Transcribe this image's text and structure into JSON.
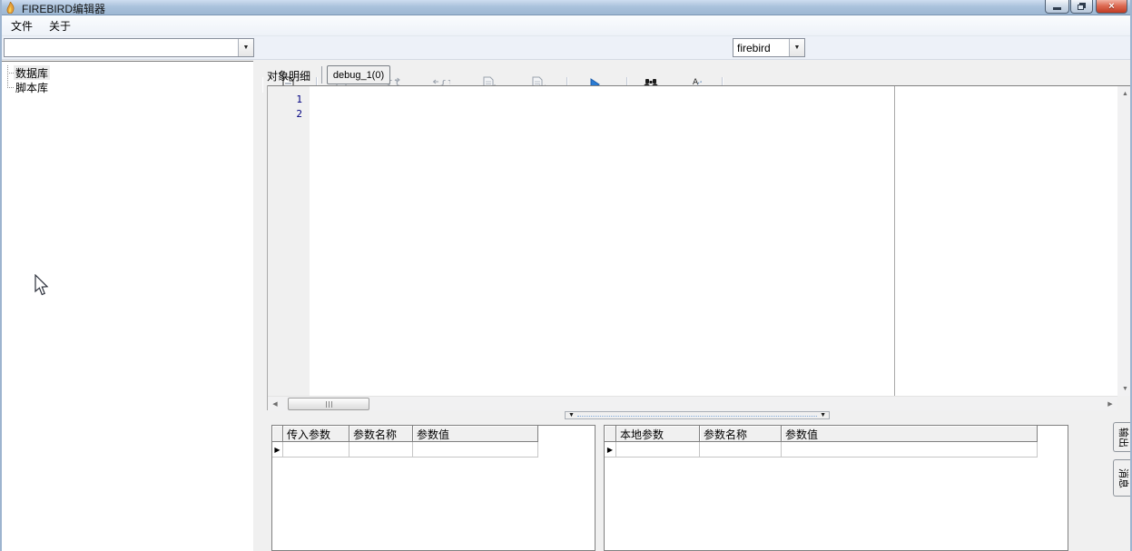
{
  "window": {
    "title": "FIREBIRD编辑器"
  },
  "menubar": {
    "items": [
      {
        "label": "文件"
      },
      {
        "label": "关于"
      }
    ]
  },
  "toolbar": {
    "object_selector": {
      "value": ""
    },
    "database_selector": {
      "value": "firebird"
    },
    "buttons": [
      {
        "name": "script-document",
        "icon": "document-icon",
        "enabled": true
      },
      {
        "name": "document-pause",
        "icon": "document-pause-icon",
        "enabled": false
      },
      {
        "name": "braces-step",
        "icon": "braces-arrow-icon",
        "enabled": false
      },
      {
        "name": "braces-add",
        "icon": "plus-braces-icon",
        "enabled": false
      },
      {
        "name": "document-down",
        "icon": "document-down-icon",
        "enabled": false
      },
      {
        "name": "document-cancel",
        "icon": "document-cross-icon",
        "enabled": false
      },
      {
        "name": "run",
        "icon": "play-icon",
        "enabled": true
      },
      {
        "name": "find",
        "icon": "binoculars-icon",
        "enabled": true
      },
      {
        "name": "replace",
        "icon": "replace-ab-icon",
        "enabled": true
      }
    ]
  },
  "sidebar": {
    "tree": [
      {
        "label": "数据库"
      },
      {
        "label": "脚本库"
      }
    ]
  },
  "content_tabs": [
    {
      "label": "对象明细",
      "selected": false
    },
    {
      "label": "debug_1(0)",
      "selected": true
    }
  ],
  "editor": {
    "line_numbers": [
      "1",
      "2"
    ],
    "text": ""
  },
  "bottom": {
    "left_grid": {
      "columns": [
        "传入参数",
        "参数名称",
        "参数值"
      ],
      "rows": [
        [
          "",
          "",
          ""
        ]
      ]
    },
    "right_grid": {
      "columns": [
        "本地参数",
        "参数名称",
        "参数值"
      ],
      "rows": [
        [
          "",
          "",
          ""
        ]
      ]
    },
    "side_tabs": [
      {
        "label": "输出"
      },
      {
        "label": "消息"
      }
    ]
  },
  "colors": {
    "titlebar_top": "#cfdef0",
    "titlebar_bottom": "#9db7d3",
    "close_red": "#c03c24",
    "play_blue": "#2b7cd3",
    "line_number_navy": "#000080",
    "toolbar_bg": "#edf1f8",
    "panel_gray": "#f0f0f0",
    "border_dark": "#808080",
    "splitter_dots": "#7fa8d9"
  }
}
